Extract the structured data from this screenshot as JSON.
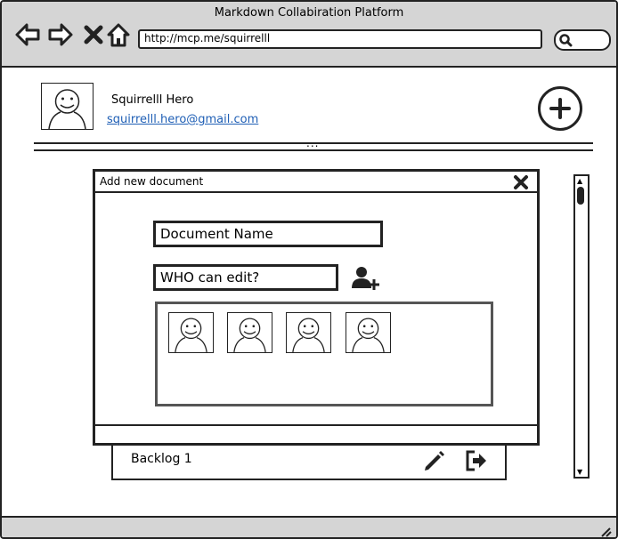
{
  "window": {
    "title": "Markdown Collabiration Platform"
  },
  "browser": {
    "url": "http://mcp.me/squirrelll",
    "icons": [
      "back-arrow-icon",
      "forward-arrow-icon",
      "stop-icon",
      "home-icon",
      "search-icon"
    ]
  },
  "user": {
    "name": "Squirrelll Hero",
    "email": "squirrelll.hero@gmail.com",
    "icons": [
      "user-avatar-icon",
      "plus-circle-icon"
    ]
  },
  "divider": {
    "label": "..."
  },
  "modal": {
    "title": "Add new document",
    "document_name_placeholder": "Document Name",
    "who_can_edit_placeholder": "WHO can edit?",
    "editors": [
      "user-avatar-icon",
      "user-avatar-icon",
      "user-avatar-icon",
      "user-avatar-icon"
    ],
    "icons": [
      "close-icon",
      "add-user-icon"
    ]
  },
  "backlog": {
    "label": "Backlog 1",
    "icons": [
      "pencil-icon",
      "sign-out-icon"
    ]
  }
}
